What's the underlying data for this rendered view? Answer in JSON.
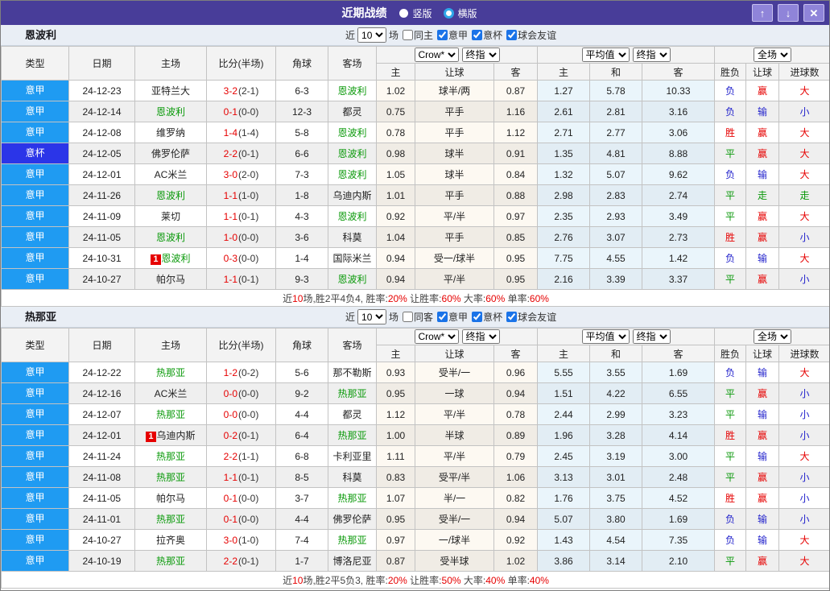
{
  "title_bar": {
    "title": "近期战绩",
    "radios": [
      {
        "label": "竖版",
        "selected": false
      },
      {
        "label": "横版",
        "selected": true
      }
    ]
  },
  "window_buttons": {
    "up": "↑",
    "down": "↓",
    "close": "✕"
  },
  "columns": {
    "left": [
      "类型",
      "日期",
      "主场",
      "比分(半场)",
      "角球",
      "客场"
    ],
    "sub": [
      "主",
      "让球",
      "客",
      "主",
      "和",
      "客",
      "胜负",
      "让球",
      "进球数"
    ]
  },
  "dropdowns": {
    "bookmaker": "Crow*",
    "stage1": "终指",
    "average": "平均值",
    "stage2": "终指",
    "scope": "全场"
  },
  "filter": {
    "prefix": "近",
    "count": "10",
    "suffix": "场"
  },
  "colors": {
    "titlebar": "#483d99",
    "leagues": {
      "意甲": "#1f9bf2",
      "意杯": "#2b35e8"
    },
    "team_highlight": "#099909",
    "score_red": "#e60000",
    "red_card_badge": "#e60000",
    "checkbox_accent": "#1a73e8",
    "outcome": {
      "r": "#e60000",
      "g": "#089708",
      "b": "#2323cc"
    }
  },
  "sections": [
    {
      "team": "恩波利",
      "filter_checkboxes": [
        {
          "label": "同主",
          "checked": false
        },
        {
          "label": "意甲",
          "checked": true
        },
        {
          "label": "意杯",
          "checked": true
        },
        {
          "label": "球会友谊",
          "checked": true
        }
      ],
      "rows": [
        {
          "lg": "意甲",
          "dt": "24-12-23",
          "h": "亚特兰大",
          "hg": 0,
          "hr": "",
          "ft": "3-2",
          "ht": "(2-1)",
          "cn": "6-3",
          "a": "恩波利",
          "ag": 1,
          "ar": "",
          "od": [
            "1.02",
            "球半/两",
            "0.87"
          ],
          "av": [
            "1.27",
            "5.78",
            "10.33"
          ],
          "rs": [
            "负b",
            "赢r",
            "大r"
          ]
        },
        {
          "lg": "意甲",
          "dt": "24-12-14",
          "h": "恩波利",
          "hg": 1,
          "hr": "",
          "ft": "0-1",
          "ht": "(0-0)",
          "cn": "12-3",
          "a": "都灵",
          "ag": 0,
          "ar": "",
          "od": [
            "0.75",
            "平手",
            "1.16"
          ],
          "av": [
            "2.61",
            "2.81",
            "3.16"
          ],
          "rs": [
            "负b",
            "输b",
            "小b"
          ]
        },
        {
          "lg": "意甲",
          "dt": "24-12-08",
          "h": "维罗纳",
          "hg": 0,
          "hr": "",
          "ft": "1-4",
          "ht": "(1-4)",
          "cn": "5-8",
          "a": "恩波利",
          "ag": 1,
          "ar": "",
          "od": [
            "0.78",
            "平手",
            "1.12"
          ],
          "av": [
            "2.71",
            "2.77",
            "3.06"
          ],
          "rs": [
            "胜r",
            "赢r",
            "大r"
          ]
        },
        {
          "lg": "意杯",
          "dt": "24-12-05",
          "h": "佛罗伦萨",
          "hg": 0,
          "hr": "",
          "ft": "2-2",
          "ht": "(0-1)",
          "cn": "6-6",
          "a": "恩波利",
          "ag": 1,
          "ar": "",
          "od": [
            "0.98",
            "球半",
            "0.91"
          ],
          "av": [
            "1.35",
            "4.81",
            "8.88"
          ],
          "rs": [
            "平g",
            "赢r",
            "大r"
          ]
        },
        {
          "lg": "意甲",
          "dt": "24-12-01",
          "h": "AC米兰",
          "hg": 0,
          "hr": "",
          "ft": "3-0",
          "ht": "(2-0)",
          "cn": "7-3",
          "a": "恩波利",
          "ag": 1,
          "ar": "",
          "od": [
            "1.05",
            "球半",
            "0.84"
          ],
          "av": [
            "1.32",
            "5.07",
            "9.62"
          ],
          "rs": [
            "负b",
            "输b",
            "大r"
          ]
        },
        {
          "lg": "意甲",
          "dt": "24-11-26",
          "h": "恩波利",
          "hg": 1,
          "hr": "",
          "ft": "1-1",
          "ht": "(1-0)",
          "cn": "1-8",
          "a": "乌迪内斯",
          "ag": 0,
          "ar": "",
          "od": [
            "1.01",
            "平手",
            "0.88"
          ],
          "av": [
            "2.98",
            "2.83",
            "2.74"
          ],
          "rs": [
            "平g",
            "走g",
            "走g"
          ]
        },
        {
          "lg": "意甲",
          "dt": "24-11-09",
          "h": "莱切",
          "hg": 0,
          "hr": "",
          "ft": "1-1",
          "ht": "(0-1)",
          "cn": "4-3",
          "a": "恩波利",
          "ag": 1,
          "ar": "",
          "od": [
            "0.92",
            "平/半",
            "0.97"
          ],
          "av": [
            "2.35",
            "2.93",
            "3.49"
          ],
          "rs": [
            "平g",
            "赢r",
            "大r"
          ]
        },
        {
          "lg": "意甲",
          "dt": "24-11-05",
          "h": "恩波利",
          "hg": 1,
          "hr": "",
          "ft": "1-0",
          "ht": "(0-0)",
          "cn": "3-6",
          "a": "科莫",
          "ag": 0,
          "ar": "",
          "od": [
            "1.04",
            "平手",
            "0.85"
          ],
          "av": [
            "2.76",
            "3.07",
            "2.73"
          ],
          "rs": [
            "胜r",
            "赢r",
            "小b"
          ]
        },
        {
          "lg": "意甲",
          "dt": "24-10-31",
          "h": "恩波利",
          "hg": 1,
          "hr": "1",
          "ft": "0-3",
          "ht": "(0-0)",
          "cn": "1-4",
          "a": "国际米兰",
          "ag": 0,
          "ar": "",
          "od": [
            "0.94",
            "受一/球半",
            "0.95"
          ],
          "av": [
            "7.75",
            "4.55",
            "1.42"
          ],
          "rs": [
            "负b",
            "输b",
            "大r"
          ]
        },
        {
          "lg": "意甲",
          "dt": "24-10-27",
          "h": "帕尔马",
          "hg": 0,
          "hr": "",
          "ft": "1-1",
          "ht": "(0-1)",
          "cn": "9-3",
          "a": "恩波利",
          "ag": 1,
          "ar": "",
          "od": [
            "0.94",
            "平/半",
            "0.95"
          ],
          "av": [
            "2.16",
            "3.39",
            "3.37"
          ],
          "rs": [
            "平g",
            "赢r",
            "小b"
          ]
        }
      ],
      "summary": [
        [
          "近",
          0
        ],
        [
          "10",
          1
        ],
        [
          "场,胜2平4负4, 胜率:",
          0
        ],
        [
          "20%",
          1
        ],
        [
          " 让胜率:",
          0
        ],
        [
          "60%",
          1
        ],
        [
          " 大率:",
          0
        ],
        [
          "60%",
          1
        ],
        [
          " 单率:",
          0
        ],
        [
          "60%",
          1
        ]
      ]
    },
    {
      "team": "热那亚",
      "filter_checkboxes": [
        {
          "label": "同客",
          "checked": false
        },
        {
          "label": "意甲",
          "checked": true
        },
        {
          "label": "意杯",
          "checked": true
        },
        {
          "label": "球会友谊",
          "checked": true
        }
      ],
      "rows": [
        {
          "lg": "意甲",
          "dt": "24-12-22",
          "h": "热那亚",
          "hg": 1,
          "hr": "",
          "ft": "1-2",
          "ht": "(0-2)",
          "cn": "5-6",
          "a": "那不勒斯",
          "ag": 0,
          "ar": "",
          "od": [
            "0.93",
            "受半/一",
            "0.96"
          ],
          "av": [
            "5.55",
            "3.55",
            "1.69"
          ],
          "rs": [
            "负b",
            "输b",
            "大r"
          ]
        },
        {
          "lg": "意甲",
          "dt": "24-12-16",
          "h": "AC米兰",
          "hg": 0,
          "hr": "",
          "ft": "0-0",
          "ht": "(0-0)",
          "cn": "9-2",
          "a": "热那亚",
          "ag": 1,
          "ar": "",
          "od": [
            "0.95",
            "一球",
            "0.94"
          ],
          "av": [
            "1.51",
            "4.22",
            "6.55"
          ],
          "rs": [
            "平g",
            "赢r",
            "小b"
          ]
        },
        {
          "lg": "意甲",
          "dt": "24-12-07",
          "h": "热那亚",
          "hg": 1,
          "hr": "",
          "ft": "0-0",
          "ht": "(0-0)",
          "cn": "4-4",
          "a": "都灵",
          "ag": 0,
          "ar": "",
          "od": [
            "1.12",
            "平/半",
            "0.78"
          ],
          "av": [
            "2.44",
            "2.99",
            "3.23"
          ],
          "rs": [
            "平g",
            "输b",
            "小b"
          ]
        },
        {
          "lg": "意甲",
          "dt": "24-12-01",
          "h": "乌迪内斯",
          "hg": 0,
          "hr": "1",
          "ft": "0-2",
          "ht": "(0-1)",
          "cn": "6-4",
          "a": "热那亚",
          "ag": 1,
          "ar": "",
          "od": [
            "1.00",
            "半球",
            "0.89"
          ],
          "av": [
            "1.96",
            "3.28",
            "4.14"
          ],
          "rs": [
            "胜r",
            "赢r",
            "小b"
          ]
        },
        {
          "lg": "意甲",
          "dt": "24-11-24",
          "h": "热那亚",
          "hg": 1,
          "hr": "",
          "ft": "2-2",
          "ht": "(1-1)",
          "cn": "6-8",
          "a": "卡利亚里",
          "ag": 0,
          "ar": "",
          "od": [
            "1.11",
            "平/半",
            "0.79"
          ],
          "av": [
            "2.45",
            "3.19",
            "3.00"
          ],
          "rs": [
            "平g",
            "输b",
            "大r"
          ]
        },
        {
          "lg": "意甲",
          "dt": "24-11-08",
          "h": "热那亚",
          "hg": 1,
          "hr": "",
          "ft": "1-1",
          "ht": "(0-1)",
          "cn": "8-5",
          "a": "科莫",
          "ag": 0,
          "ar": "",
          "od": [
            "0.83",
            "受平/半",
            "1.06"
          ],
          "av": [
            "3.13",
            "3.01",
            "2.48"
          ],
          "rs": [
            "平g",
            "赢r",
            "小b"
          ]
        },
        {
          "lg": "意甲",
          "dt": "24-11-05",
          "h": "帕尔马",
          "hg": 0,
          "hr": "",
          "ft": "0-1",
          "ht": "(0-0)",
          "cn": "3-7",
          "a": "热那亚",
          "ag": 1,
          "ar": "",
          "od": [
            "1.07",
            "半/一",
            "0.82"
          ],
          "av": [
            "1.76",
            "3.75",
            "4.52"
          ],
          "rs": [
            "胜r",
            "赢r",
            "小b"
          ]
        },
        {
          "lg": "意甲",
          "dt": "24-11-01",
          "h": "热那亚",
          "hg": 1,
          "hr": "",
          "ft": "0-1",
          "ht": "(0-0)",
          "cn": "4-4",
          "a": "佛罗伦萨",
          "ag": 0,
          "ar": "",
          "od": [
            "0.95",
            "受半/一",
            "0.94"
          ],
          "av": [
            "5.07",
            "3.80",
            "1.69"
          ],
          "rs": [
            "负b",
            "输b",
            "小b"
          ]
        },
        {
          "lg": "意甲",
          "dt": "24-10-27",
          "h": "拉齐奥",
          "hg": 0,
          "hr": "",
          "ft": "3-0",
          "ht": "(1-0)",
          "cn": "7-4",
          "a": "热那亚",
          "ag": 1,
          "ar": "",
          "od": [
            "0.97",
            "一/球半",
            "0.92"
          ],
          "av": [
            "1.43",
            "4.54",
            "7.35"
          ],
          "rs": [
            "负b",
            "输b",
            "大r"
          ]
        },
        {
          "lg": "意甲",
          "dt": "24-10-19",
          "h": "热那亚",
          "hg": 1,
          "hr": "",
          "ft": "2-2",
          "ht": "(0-1)",
          "cn": "1-7",
          "a": "博洛尼亚",
          "ag": 0,
          "ar": "",
          "od": [
            "0.87",
            "受半球",
            "1.02"
          ],
          "av": [
            "3.86",
            "3.14",
            "2.10"
          ],
          "rs": [
            "平g",
            "赢r",
            "大r"
          ]
        }
      ],
      "summary": [
        [
          "近",
          0
        ],
        [
          "10",
          1
        ],
        [
          "场,胜2平5负3, 胜率:",
          0
        ],
        [
          "20%",
          1
        ],
        [
          " 让胜率:",
          0
        ],
        [
          "50%",
          1
        ],
        [
          " 大率:",
          0
        ],
        [
          "40%",
          1
        ],
        [
          " 单率:",
          0
        ],
        [
          "40%",
          1
        ]
      ]
    }
  ]
}
